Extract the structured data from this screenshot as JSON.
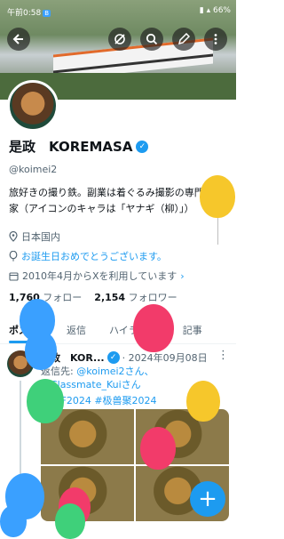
{
  "status_bar": {
    "time": "午前0:58",
    "notification_badge": "B",
    "battery": "66%"
  },
  "profile": {
    "display_name": "是政　KOREMASA",
    "handle": "@koimei2",
    "bio": "旅好きの撮り鉄。副業は着ぐるみ撮影の専門家（アイコンのキャラは「ヤナギ（柳）」）",
    "location": "日本国内",
    "birthday_text": "お誕生日おめでとうございます。",
    "joined": "2010年4月からXを利用しています",
    "following_count": "1,760",
    "following_label": "フォロー",
    "followers_count": "2,154",
    "followers_label": "フォロワー"
  },
  "tabs": [
    {
      "label": "ポスト",
      "active": true
    },
    {
      "label": "返信",
      "active": false
    },
    {
      "label": "ハイライト",
      "active": false
    },
    {
      "label": "記事",
      "active": false
    }
  ],
  "post": {
    "author": "是政　KOR...",
    "meta": "· 2024年09月08日",
    "reply_prefix": "返信先:",
    "reply_user1": "@koimei2さん、",
    "reply_user2": "@Classmate_Kuiさん",
    "hashtags": "#SFF2024 #极兽聚2024"
  },
  "icons": {
    "back": "back-arrow-icon",
    "no_notify": "notification-off-icon",
    "search": "search-icon",
    "edit": "edit-icon",
    "more": "more-vertical-icon",
    "compose": "plus-icon"
  },
  "colors": {
    "accent": "#1d9bf0"
  }
}
